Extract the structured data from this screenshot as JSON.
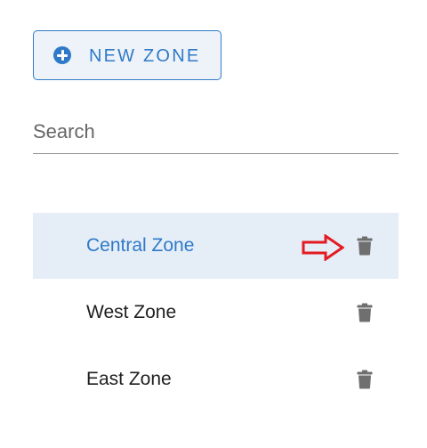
{
  "toolbar": {
    "new_zone_label": "NEW ZONE",
    "new_zone_icon": "plus-circle-icon",
    "accent_color": "#2f7ac8"
  },
  "search": {
    "label": "Search",
    "value": ""
  },
  "zones": [
    {
      "name": "Central Zone",
      "selected": true,
      "action_icon": "trash-icon"
    },
    {
      "name": "West Zone",
      "selected": false,
      "action_icon": "trash-icon"
    },
    {
      "name": "East Zone",
      "selected": false,
      "action_icon": "trash-icon"
    }
  ],
  "annotation": {
    "icon": "red-arrow-icon",
    "color": "#e31b23",
    "points_to": "delete Central Zone"
  }
}
